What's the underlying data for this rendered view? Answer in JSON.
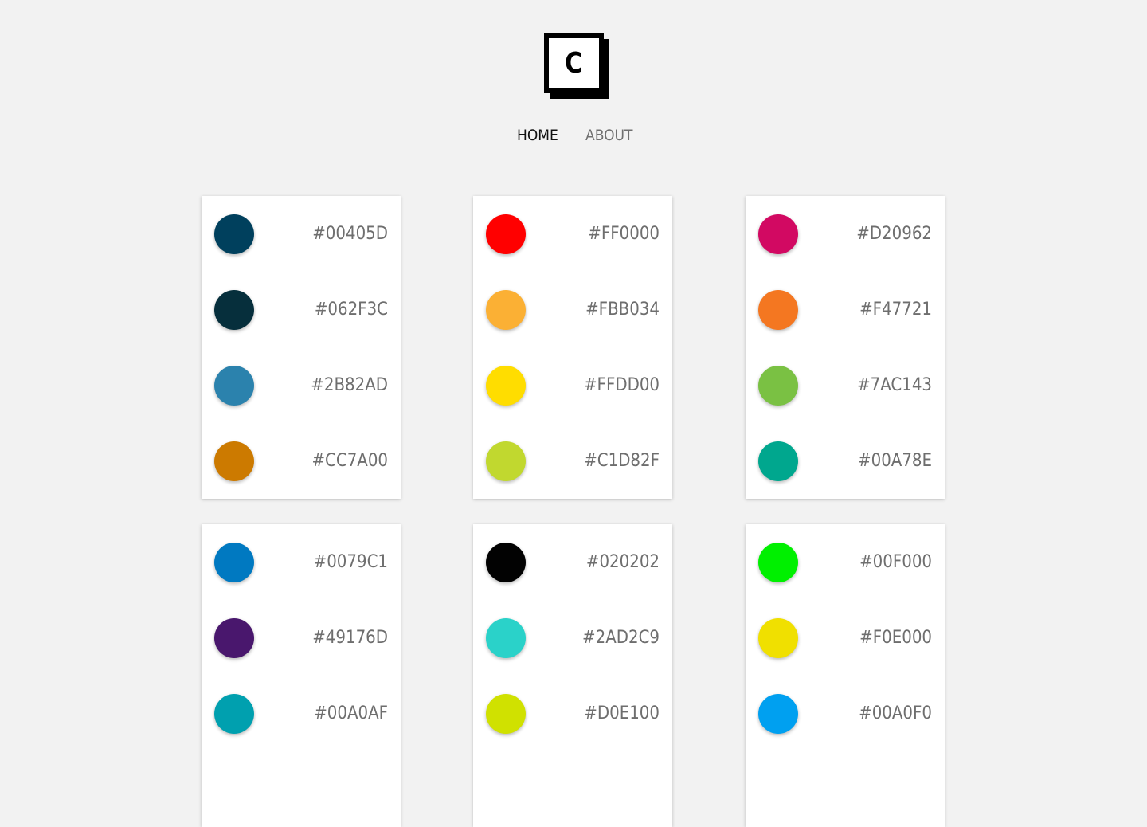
{
  "logo": {
    "letter": "C"
  },
  "nav": {
    "home": "HOME",
    "about": "ABOUT"
  },
  "palettes": [
    {
      "colors": [
        {
          "hex": "#00405D",
          "color": "#00405D"
        },
        {
          "hex": "#062F3C",
          "color": "#062F3C"
        },
        {
          "hex": "#2B82AD",
          "color": "#2B82AD"
        },
        {
          "hex": "#CC7A00",
          "color": "#CC7A00"
        }
      ]
    },
    {
      "colors": [
        {
          "hex": "#FF0000",
          "color": "#FF0000"
        },
        {
          "hex": "#FBB034",
          "color": "#FBB034"
        },
        {
          "hex": "#FFDD00",
          "color": "#FFDD00"
        },
        {
          "hex": "#C1D82F",
          "color": "#C1D82F"
        }
      ]
    },
    {
      "colors": [
        {
          "hex": "#D20962",
          "color": "#D20962"
        },
        {
          "hex": "#F47721",
          "color": "#F47721"
        },
        {
          "hex": "#7AC143",
          "color": "#7AC143"
        },
        {
          "hex": "#00A78E",
          "color": "#00A78E"
        }
      ]
    },
    {
      "colors": [
        {
          "hex": "#0079C1",
          "color": "#0079C1"
        },
        {
          "hex": "#49176D",
          "color": "#49176D"
        },
        {
          "hex": "#00A0AF",
          "color": "#00A0AF"
        }
      ]
    },
    {
      "colors": [
        {
          "hex": "#020202",
          "color": "#020202"
        },
        {
          "hex": "#2AD2C9",
          "color": "#2AD2C9"
        },
        {
          "hex": "#D0E100",
          "color": "#D0E100"
        }
      ]
    },
    {
      "colors": [
        {
          "hex": "#00F000",
          "color": "#00F000"
        },
        {
          "hex": "#F0E000",
          "color": "#F0E000"
        },
        {
          "hex": "#00A0F0",
          "color": "#00A0F0"
        }
      ]
    }
  ]
}
